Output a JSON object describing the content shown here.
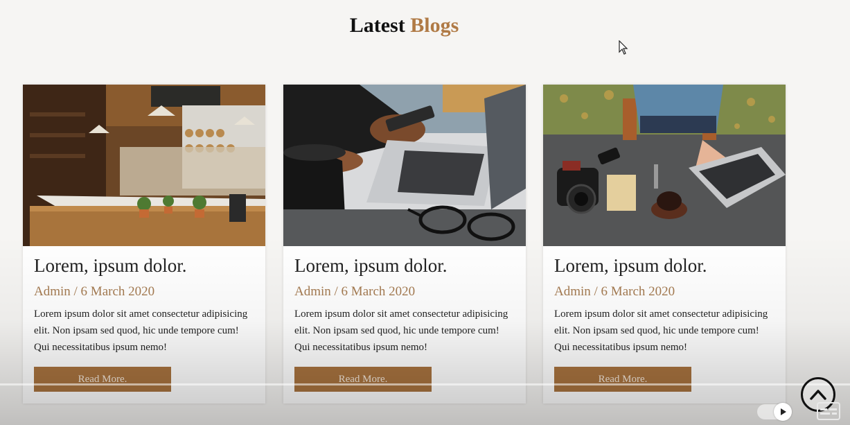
{
  "section": {
    "title_main": "Latest",
    "title_accent": "Blogs"
  },
  "cards": [
    {
      "image": "bakery-cafe-counter",
      "title": "Lorem, ipsum dolor.",
      "meta": "Admin / 6 March 2020",
      "text": "Lorem ipsum dolor sit amet consectetur adipisicing elit. Non ipsam sed quod, hic unde tempore cum! Qui necessitatibus ipsum nemo!",
      "button": "Read More."
    },
    {
      "image": "laptop-phone-coffee-glasses",
      "title": "Lorem, ipsum dolor.",
      "meta": "Admin / 6 March 2020",
      "text": "Lorem ipsum dolor sit amet consectetur adipisicing elit. Non ipsam sed quod, hic unde tempore cum! Qui necessitatibus ipsum nemo!",
      "button": "Read More."
    },
    {
      "image": "laptop-camera-desk-topview",
      "title": "Lorem, ipsum dolor.",
      "meta": "Admin / 6 March 2020",
      "text": "Lorem ipsum dolor sit amet consectetur adipisicing elit. Non ipsam sed quod, hic unde tempore cum! Qui necessitatibus ipsum nemo!",
      "button": "Read More."
    }
  ],
  "player": {
    "scroll_top_icon": "chevron-up-icon",
    "autoplay_icon": "play-icon",
    "subtitles_icon": "subtitles-icon"
  },
  "colors": {
    "accent": "#b07a45",
    "button": "#a8733f",
    "meta": "#a57b51"
  }
}
